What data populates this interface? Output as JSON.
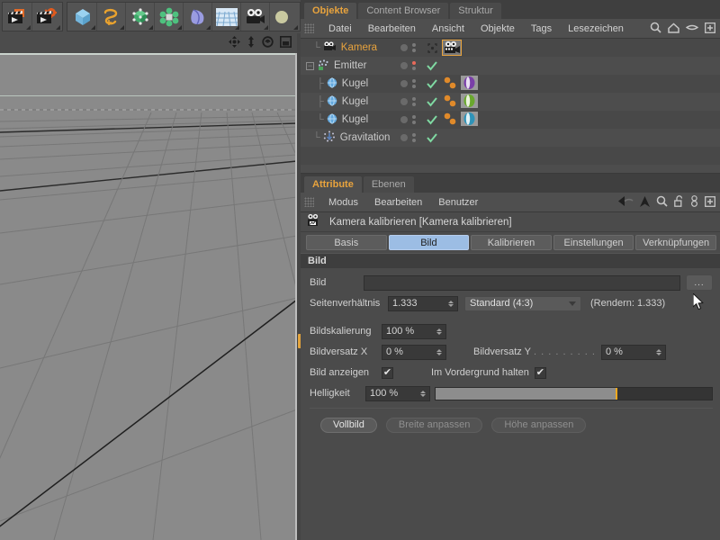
{
  "toolbar": {
    "groups": [
      {
        "buttons": [
          {
            "name": "render-view-button",
            "icon": "clapperboard-render-icon"
          },
          {
            "name": "render-settings-button",
            "icon": "clapperboard-gear-icon"
          }
        ]
      },
      {
        "buttons": [
          {
            "name": "cube-primitive-button",
            "icon": "cube-icon"
          },
          {
            "name": "spline-button",
            "icon": "spline-curve-icon"
          },
          {
            "name": "nurbs-button",
            "icon": "green-cube-points-icon"
          },
          {
            "name": "array-button",
            "icon": "green-cluster-icon"
          },
          {
            "name": "deformer-button",
            "icon": "blue-bend-icon"
          },
          {
            "name": "scene-button",
            "icon": "floor-grid-icon"
          },
          {
            "name": "camera-button",
            "icon": "camera-icon"
          },
          {
            "name": "light-button",
            "icon": "light-icon"
          }
        ]
      }
    ]
  },
  "viewport": {
    "nav_icons": [
      {
        "name": "move-camera-icon",
        "glyph": "move"
      },
      {
        "name": "scale-camera-icon",
        "glyph": "scale"
      },
      {
        "name": "rotate-camera-icon",
        "glyph": "rotate"
      },
      {
        "name": "toggle-layout-icon",
        "glyph": "layout"
      }
    ]
  },
  "object_manager": {
    "tabs": [
      {
        "label": "Objekte",
        "active": true
      },
      {
        "label": "Content Browser",
        "active": false
      },
      {
        "label": "Struktur",
        "active": false
      }
    ],
    "menu": [
      "Datei",
      "Bearbeiten",
      "Ansicht",
      "Objekte",
      "Tags",
      "Lesezeichen"
    ],
    "menu_icons": [
      {
        "name": "search-icon"
      },
      {
        "name": "home-icon"
      },
      {
        "name": "eye-icon"
      },
      {
        "name": "add-icon"
      }
    ],
    "rows": [
      {
        "label": "Kamera",
        "icon": "camera-object-icon",
        "depth": 1,
        "selected": true,
        "dot_state": "normal",
        "tick": false,
        "tags": [
          "camera-tag"
        ]
      },
      {
        "label": "Emitter",
        "icon": "emitter-object-icon",
        "depth": 0,
        "selected": false,
        "dot_state": "red",
        "tick": true,
        "tags": []
      },
      {
        "label": "Kugel",
        "icon": "sphere-object-icon",
        "depth": 1,
        "selected": false,
        "dot_state": "normal",
        "tick": true,
        "tags": [
          "material-dots",
          "material-purple"
        ]
      },
      {
        "label": "Kugel",
        "icon": "sphere-object-icon",
        "depth": 1,
        "selected": false,
        "dot_state": "normal",
        "tick": true,
        "tags": [
          "material-dots",
          "material-green"
        ]
      },
      {
        "label": "Kugel",
        "icon": "sphere-object-icon",
        "depth": 1,
        "selected": false,
        "dot_state": "normal",
        "tick": true,
        "tags": [
          "material-dots",
          "material-blue"
        ]
      },
      {
        "label": "Gravitation",
        "icon": "gravitation-object-icon",
        "depth": 1,
        "selected": false,
        "dot_state": "normal",
        "tick": true,
        "tags": []
      }
    ]
  },
  "attribute_manager": {
    "tabs": [
      {
        "label": "Attribute",
        "active": true
      },
      {
        "label": "Ebenen",
        "active": false
      }
    ],
    "menu": [
      "Modus",
      "Bearbeiten",
      "Benutzer"
    ],
    "menu_icons": [
      {
        "name": "back-arrow-icon"
      },
      {
        "name": "up-arrow-icon"
      },
      {
        "name": "search-icon"
      },
      {
        "name": "lock-icon"
      },
      {
        "name": "link-icon"
      },
      {
        "name": "add-icon"
      }
    ],
    "object_title": "Kamera kalibrieren [Kamera kalibrieren]",
    "object_icon": "camera-calibrator-icon",
    "tabs_row": [
      {
        "label": "Basis",
        "active": false
      },
      {
        "label": "Bild",
        "active": true
      },
      {
        "label": "Kalibrieren",
        "active": false
      },
      {
        "label": "Einstellungen",
        "active": false
      },
      {
        "label": "Verknüpfungen",
        "active": false
      }
    ],
    "section_title": "Bild",
    "fields": {
      "bild_label": "Bild",
      "bild_value": "",
      "browse_button": "...",
      "seitenverhaeltnis_label": "Seitenverhältnis",
      "seitenverhaeltnis_value": "1.333",
      "preset_value": "Standard (4:3)",
      "render_note": "(Rendern: 1.333)",
      "bildskalierung_label": "Bildskalierung",
      "bildskalierung_value": "100 %",
      "bildversatz_x_label": "Bildversatz X",
      "bildversatz_x_value": "0 %",
      "bildversatz_y_label": "Bildversatz Y",
      "bildversatz_y_dots": ". . . . . . . . .",
      "bildversatz_y_value": "0 %",
      "bild_anzeigen_label": "Bild anzeigen",
      "bild_anzeigen_checked": "✔",
      "vordergrund_label": "Im Vordergrund halten",
      "vordergrund_checked": "✔",
      "helligkeit_label": "Helligkeit",
      "helligkeit_value": "100 %",
      "helligkeit_fill_percent": 65
    },
    "buttons": [
      {
        "label": "Vollbild",
        "enabled": true
      },
      {
        "label": "Breite anpassen",
        "enabled": false
      },
      {
        "label": "Höhe anpassen",
        "enabled": false
      }
    ]
  },
  "colors": {
    "accent_orange": "#e8a33d",
    "tab_active_blue": "#9cbde4",
    "slider_knob": "#f0a81e",
    "panel_bg": "#4b4b4b",
    "viewport_bg": "#8a8a8a"
  }
}
